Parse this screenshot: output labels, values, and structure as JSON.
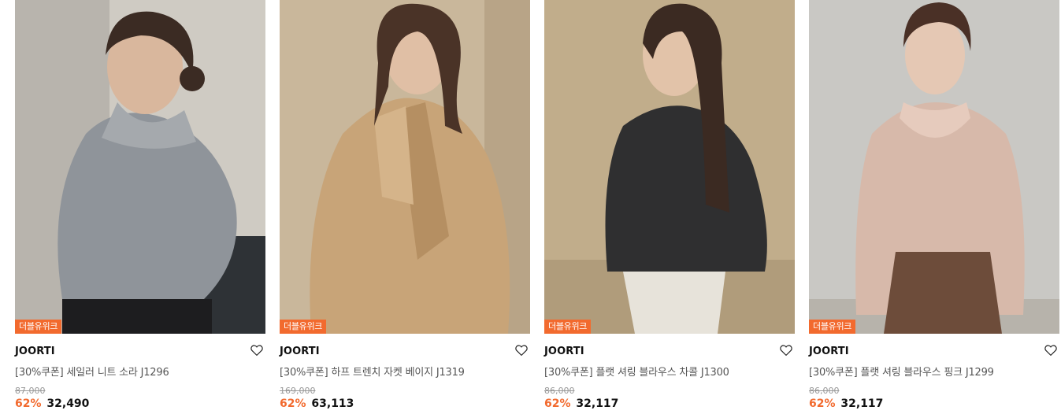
{
  "products": [
    {
      "badge": "더블유위크",
      "brand": "JOORTI",
      "name": "[30%쿠폰] 세일러 니트 소라 J1296",
      "original_price": "87,000",
      "discount": "62%",
      "price": "32,490",
      "image_icon": "model-photo-knit-gray"
    },
    {
      "badge": "더블유위크",
      "brand": "JOORTI",
      "name": "[30%쿠폰] 하프 트렌치 자켓 베이지 J1319",
      "original_price": "169,000",
      "discount": "62%",
      "price": "63,113",
      "image_icon": "model-photo-trench-beige"
    },
    {
      "badge": "더블유위크",
      "brand": "JOORTI",
      "name": "[30%쿠폰] 플랫 셔링 블라우스 차콜 J1300",
      "original_price": "86,000",
      "discount": "62%",
      "price": "32,117",
      "image_icon": "model-photo-blouse-charcoal"
    },
    {
      "badge": "더블유위크",
      "brand": "JOORTI",
      "name": "[30%쿠폰] 플랫 셔링 블라우스 핑크 J1299",
      "original_price": "86,000",
      "discount": "62%",
      "price": "32,117",
      "image_icon": "model-photo-blouse-pink"
    }
  ],
  "wishlist_icon": "heart-outline-icon",
  "colors": {
    "accent": "#f26a2e",
    "text": "#111111",
    "muted": "#999999"
  }
}
